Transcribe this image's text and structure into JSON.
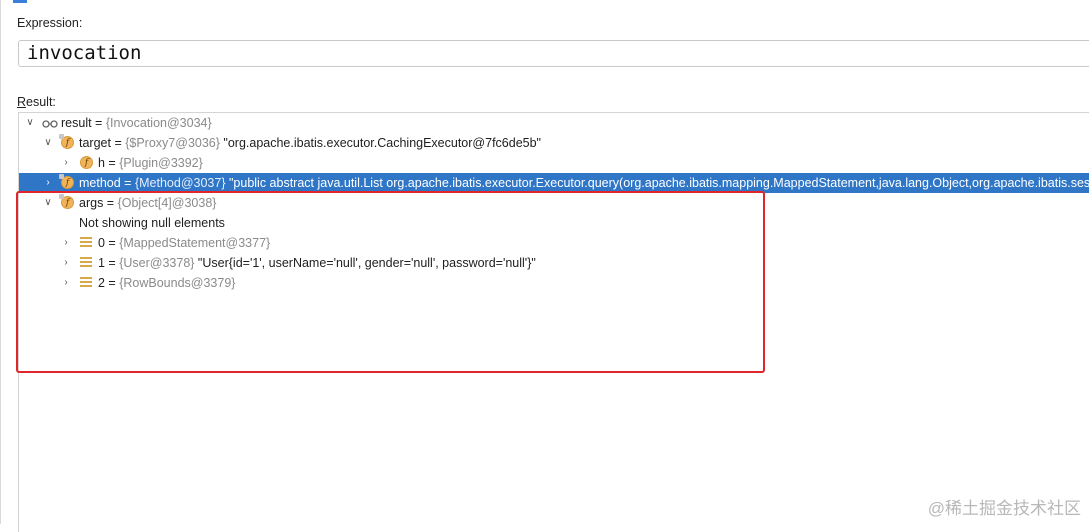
{
  "expression": {
    "label": "Expression:",
    "value": "invocation"
  },
  "result": {
    "label_underlined": "R",
    "label_rest": "esult:",
    "rows": [
      {
        "name": "result",
        "eq": " = ",
        "ref": "{Invocation@3034}",
        "value": ""
      },
      {
        "name": "target",
        "eq": " = ",
        "ref": "{$Proxy7@3036}",
        "value": " \"org.apache.ibatis.executor.CachingExecutor@7fc6de5b\""
      },
      {
        "name": "h",
        "eq": " = ",
        "ref": "{Plugin@3392}",
        "value": ""
      },
      {
        "name": "method",
        "eq": " = ",
        "ref": "{Method@3037}",
        "value": " \"public abstract java.util.List org.apache.ibatis.executor.Executor.query(org.apache.ibatis.mapping.MappedStatement,java.lang.Object,org.apache.ibatis.session.RowBounds,org.apache.ibatis.session.ResultHandler)\""
      },
      {
        "name": "args",
        "eq": " = ",
        "ref": "{Object[4]@3038}",
        "value": ""
      },
      {
        "message": "Not showing null elements"
      },
      {
        "name": "0",
        "eq": " = ",
        "ref": "{MappedStatement@3377}",
        "value": ""
      },
      {
        "name": "1",
        "eq": " = ",
        "ref": "{User@3378}",
        "value": " \"User{id='1', userName='null', gender='null', password='null'}\""
      },
      {
        "name": "2",
        "eq": " = ",
        "ref": "{RowBounds@3379}",
        "value": ""
      }
    ]
  },
  "watermark": "@稀土掘金技术社区",
  "colors": {
    "selection": "#2f76c7",
    "highlight_border": "#e0262a"
  }
}
